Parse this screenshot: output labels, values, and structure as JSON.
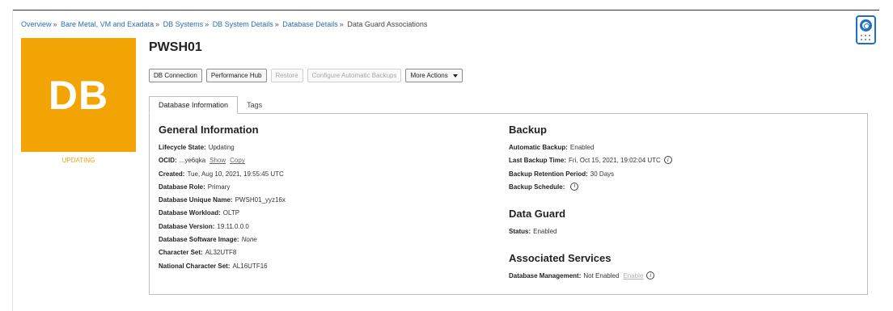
{
  "breadcrumb": [
    {
      "label": "Overview",
      "link": true
    },
    {
      "label": "Bare Metal, VM and Exadata",
      "link": true
    },
    {
      "label": "DB Systems",
      "link": true
    },
    {
      "label": "DB System Details",
      "link": true
    },
    {
      "label": "Database Details",
      "link": true
    },
    {
      "label": "Data Guard Associations",
      "link": false
    }
  ],
  "breadcrumb_separator": "»",
  "tile": {
    "text": "DB",
    "status": "UPDATING",
    "color": "#f3a405"
  },
  "page_title": "PWSH01",
  "toolbar": {
    "db_connection": "DB Connection",
    "performance_hub": "Performance Hub",
    "restore": "Restore",
    "configure_backups": "Configure Automatic Backups",
    "more_actions": "More Actions"
  },
  "tabs": [
    {
      "label": "Database Information",
      "active": true
    },
    {
      "label": "Tags",
      "active": false
    }
  ],
  "general": {
    "title": "General Information",
    "lifecycle_label": "Lifecycle State:",
    "lifecycle_value": "Updating",
    "ocid_label": "OCID:",
    "ocid_value": "...ye6qka",
    "ocid_show": "Show",
    "ocid_copy": "Copy",
    "created_label": "Created:",
    "created_value": "Tue, Aug 10, 2021, 19:55:45 UTC",
    "role_label": "Database Role:",
    "role_value": "Primary",
    "unique_name_label": "Database Unique Name:",
    "unique_name_value": "PWSH01_yyz16x",
    "workload_label": "Database Workload:",
    "workload_value": "OLTP",
    "version_label": "Database Version:",
    "version_value": "19.11.0.0.0",
    "software_image_label": "Database Software Image:",
    "software_image_value": "None",
    "charset_label": "Character Set:",
    "charset_value": "AL32UTF8",
    "ncharset_label": "National Character Set:",
    "ncharset_value": "AL16UTF16"
  },
  "backup": {
    "title": "Backup",
    "auto_label": "Automatic Backup:",
    "auto_value": "Enabled",
    "last_label": "Last Backup Time:",
    "last_value": "Fri, Oct 15, 2021, 19:02:04 UTC",
    "retention_label": "Backup Retention Period:",
    "retention_value": "30 Days",
    "schedule_label": "Backup Schedule:"
  },
  "dataguard": {
    "title": "Data Guard",
    "status_label": "Status:",
    "status_value": "Enabled"
  },
  "services": {
    "title": "Associated Services",
    "mgmt_label": "Database Management:",
    "mgmt_value": "Not Enabled",
    "mgmt_enable": "Enable"
  },
  "info_glyph": "i",
  "icons": {
    "help": "life-ring-icon",
    "apps": "dots-grid-icon",
    "caret": "caret-down-icon",
    "info": "info-icon"
  }
}
